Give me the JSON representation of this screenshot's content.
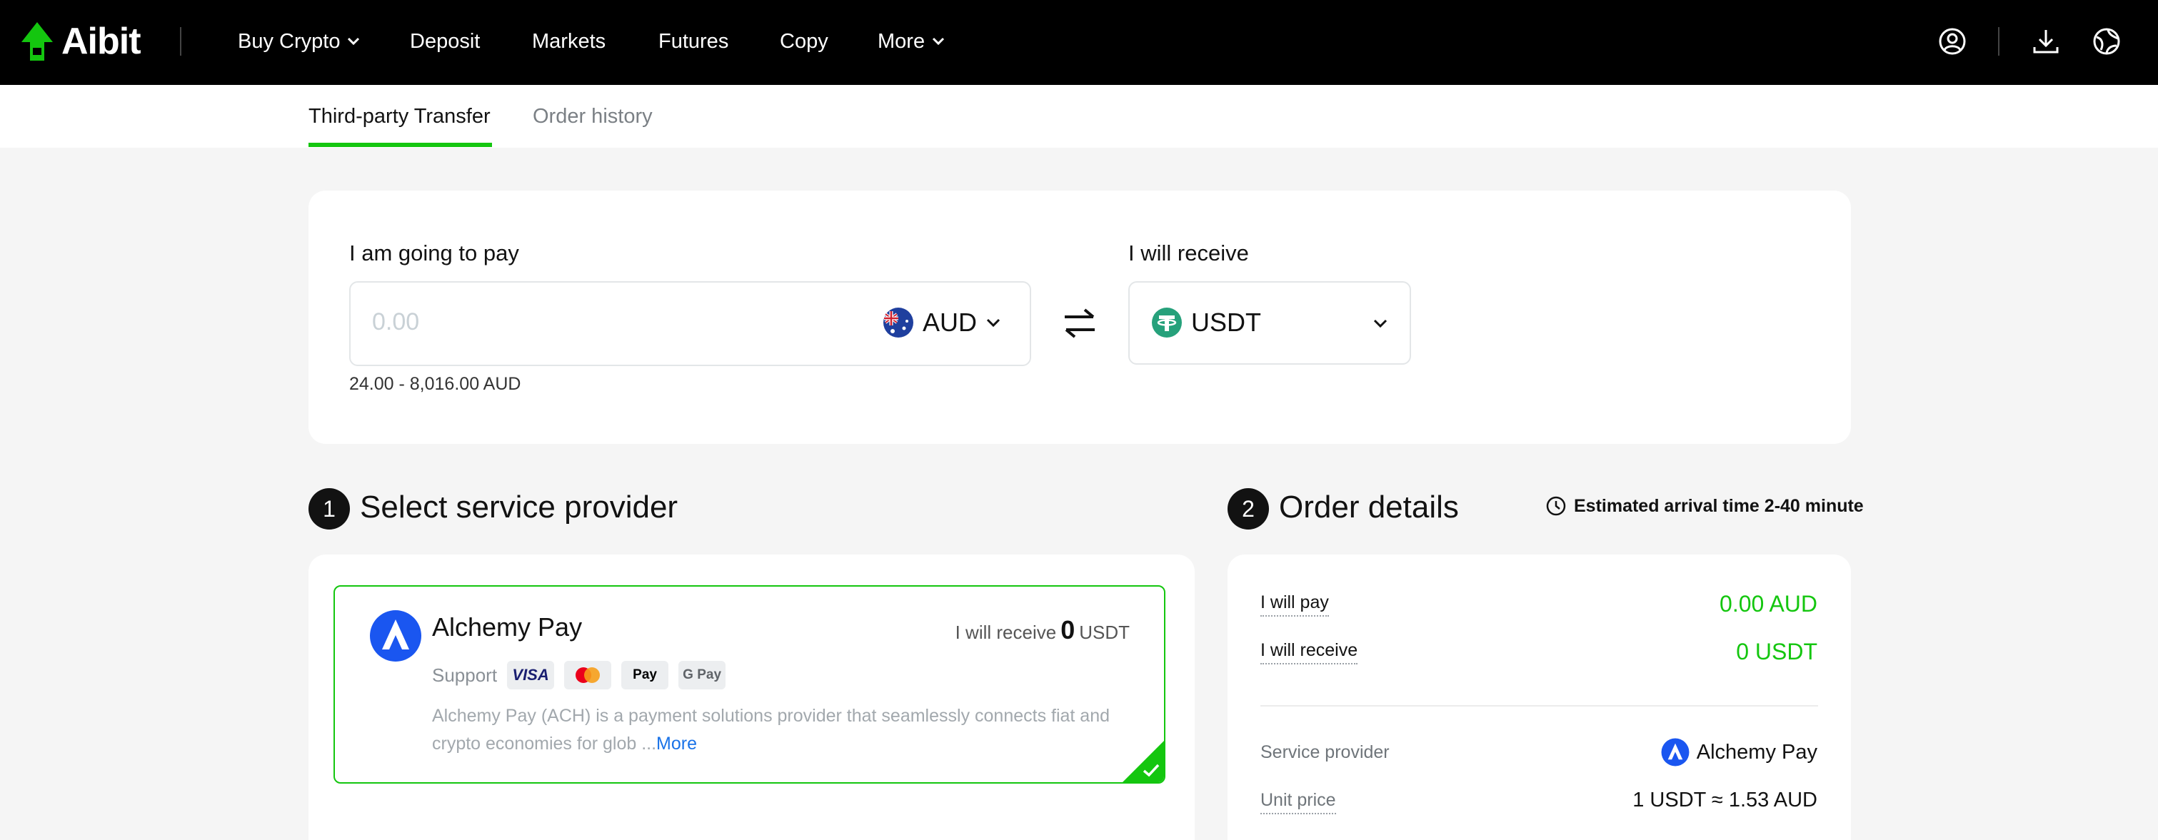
{
  "nav": {
    "brand": "Aibit",
    "items": [
      {
        "label": "Buy Crypto",
        "dropdown": true
      },
      {
        "label": "Deposit"
      },
      {
        "label": "Markets"
      },
      {
        "label": "Futures"
      },
      {
        "label": "Copy"
      },
      {
        "label": "More",
        "dropdown": true
      }
    ],
    "icons": [
      "account-icon",
      "download-icon",
      "globe-icon"
    ]
  },
  "tabs": {
    "active": "Third-party Transfer",
    "inactive": "Order history"
  },
  "exchange": {
    "pay_label": "I am going to pay",
    "pay_placeholder": "0.00",
    "pay_currency": "AUD",
    "range": "24.00 - 8,016.00 AUD",
    "receive_label": "I will receive",
    "receive_currency": "USDT"
  },
  "provider_section": {
    "step": "1",
    "title": "Select service provider",
    "provider": {
      "name": "Alchemy Pay",
      "receive_prefix": "I will receive",
      "receive_amount": "0",
      "receive_unit": "USDT",
      "support_label": "Support",
      "methods": [
        "VISA",
        "Mastercard",
        "Apple Pay",
        "G Pay"
      ],
      "description": "Alchemy Pay (ACH) is a payment solutions provider that seamlessly connects fiat and crypto economies for glob ...",
      "more_label": "More"
    }
  },
  "order_section": {
    "step": "2",
    "title": "Order details",
    "eta": "Estimated arrival time 2-40 minute",
    "pay_label": "I will pay",
    "pay_value": "0.00 AUD",
    "receive_label": "I will receive",
    "receive_value": "0 USDT",
    "provider_label": "Service provider",
    "provider_value": "Alchemy Pay",
    "unit_price_label": "Unit price",
    "unit_price_value": "1 USDT ≈ 1.53 AUD"
  },
  "colors": {
    "accent": "#14c60f",
    "nav_bg": "#000000",
    "link": "#1a73e8"
  }
}
